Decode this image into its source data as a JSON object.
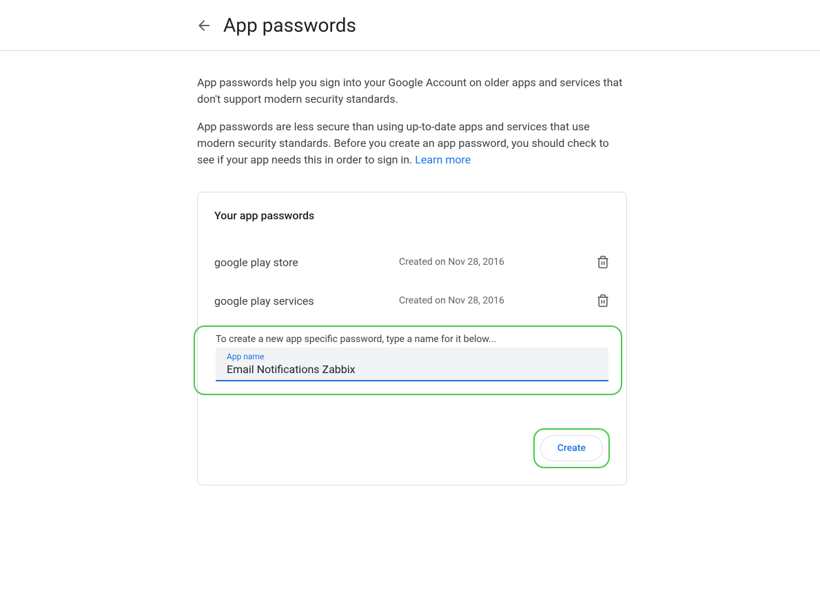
{
  "header": {
    "title": "App passwords"
  },
  "description": {
    "para1": "App passwords help you sign into your Google Account on older apps and services that don't support modern security standards.",
    "para2": "App passwords are less secure than using up-to-date apps and services that use modern security standards. Before you create an app password, you should check to see if your app needs this in order to sign in.",
    "learn_more": "Learn more"
  },
  "card": {
    "title": "Your app passwords",
    "passwords": [
      {
        "name": "google play store",
        "created": "Created on Nov 28, 2016"
      },
      {
        "name": "google play services",
        "created": "Created on Nov 28, 2016"
      }
    ],
    "create_prompt": "To create a new app specific password, type a name for it below...",
    "input_label": "App name",
    "input_value": "Email Notifications Zabbix",
    "create_button": "Create"
  }
}
